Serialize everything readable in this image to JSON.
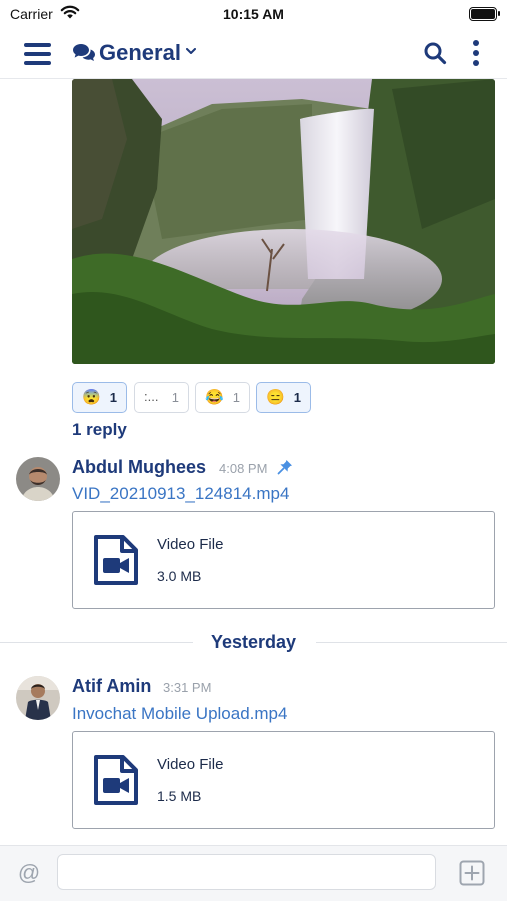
{
  "status_bar": {
    "carrier": "Carrier",
    "time": "10:15 AM"
  },
  "nav": {
    "channel_title": "General"
  },
  "reactions": [
    {
      "emoji": "😨",
      "count": "1",
      "active": true
    },
    {
      "emoji": ":...",
      "count": "1",
      "active": false
    },
    {
      "emoji": "😂",
      "count": "1",
      "active": false
    },
    {
      "emoji": "😑",
      "count": "1",
      "active": true
    }
  ],
  "thread": {
    "reply_label": "1 reply"
  },
  "messages": [
    {
      "author": "Abdul Mughees",
      "time": "4:08 PM",
      "pinned": true,
      "file_name": "VID_20210913_124814.mp4",
      "file_type": "Video File",
      "file_size": "3.0 MB"
    },
    {
      "author": "Atif Amin",
      "time": "3:31 PM",
      "pinned": false,
      "file_name": "Invochat Mobile Upload.mp4",
      "file_type": "Video File",
      "file_size": "1.5 MB"
    }
  ],
  "date_divider": "Yesterday",
  "composer": {
    "placeholder": ""
  },
  "colors": {
    "brand": "#1e3a7a",
    "link": "#3a75c4",
    "pin": "#4a90e2"
  },
  "icons": [
    "wifi-icon",
    "battery-icon",
    "menu-icon",
    "chat-bubbles-icon",
    "chevron-down-icon",
    "search-icon",
    "more-vertical-icon",
    "pin-icon",
    "video-file-icon",
    "at-icon",
    "plus-square-icon"
  ]
}
